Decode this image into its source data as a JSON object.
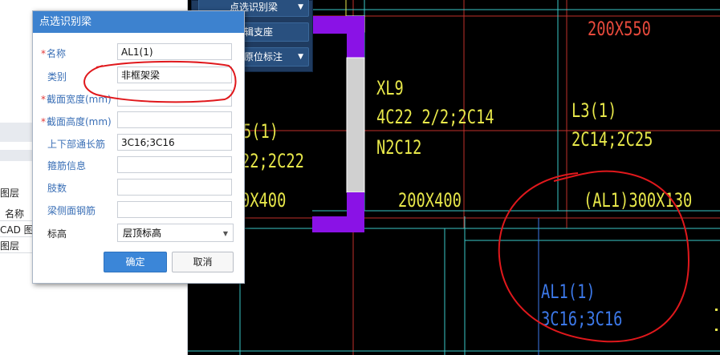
{
  "left_panel": {
    "layer_label_1": "图层",
    "col_name": "名称",
    "row1": "CAD 图",
    "row2": "图层"
  },
  "toolbar": {
    "btn1": "点选识别梁",
    "btn2": "编辑支座",
    "btn3": "识别原位标注"
  },
  "dialog": {
    "title": "点选识别梁",
    "rows": [
      {
        "label": "名称",
        "required": true,
        "value": ""
      },
      {
        "label": "类别",
        "required": false,
        "value": "非框架梁"
      },
      {
        "label": "截面宽度(mm)",
        "required": true,
        "value": ""
      },
      {
        "label": "截面高度(mm)",
        "required": true,
        "value": ""
      },
      {
        "label": "上下部通长筋",
        "required": false,
        "value": "3C16;3C16"
      },
      {
        "label": "箍筋信息",
        "required": false,
        "value": ""
      },
      {
        "label": "肢数",
        "required": false,
        "value": ""
      },
      {
        "label": "梁侧面钢筋",
        "required": false,
        "value": ""
      },
      {
        "label": "标高",
        "required": false,
        "value": "层顶标高"
      }
    ],
    "name_value": "AL1(1)",
    "req_mark": "*",
    "ok": "确定",
    "cancel": "取消"
  },
  "cad": {
    "t_200x550": "200X550",
    "t_xl9": "XL9",
    "t_xl9_a": "4C22 2/2;2C14",
    "t_xl9_b": "N2C12",
    "t_l3": "L3(1)",
    "t_l3_a": "2C14;2C25",
    "t_left1": "5(1)",
    "t_left2": "22;2C22",
    "t_left3": "0X400",
    "t_200x400": "200X400",
    "t_al1_size": "(AL1)300X130",
    "t_al1": "AL1(1)",
    "t_al1_bars": "3C16;3C16"
  },
  "colors": {
    "cad_yellow": "#e8e84a",
    "cad_red": "#e84a3c",
    "cad_blue": "#3c78e8",
    "cad_cyan": "#3ac8c8",
    "cad_purple": "#8a12e6",
    "dialog_title": "#3d82cf"
  }
}
